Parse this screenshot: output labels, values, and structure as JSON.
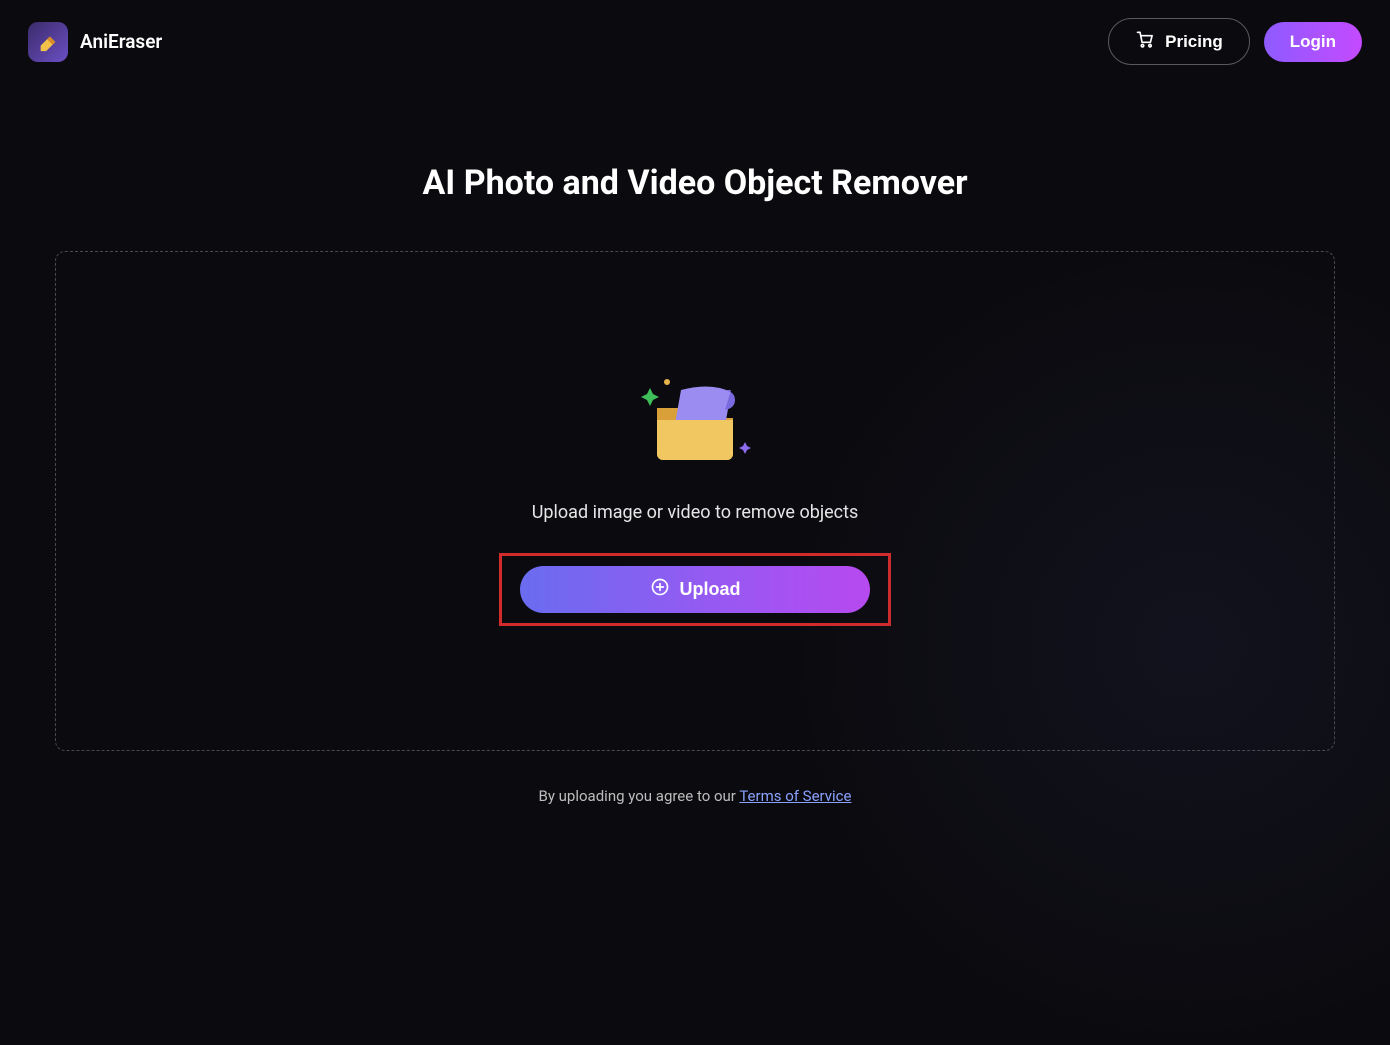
{
  "header": {
    "brand_name": "AniEraser",
    "pricing_label": "Pricing",
    "login_label": "Login"
  },
  "main": {
    "title": "AI Photo and Video Object Remover",
    "drop_caption": "Upload image or video to remove objects",
    "upload_label": "Upload"
  },
  "footer": {
    "agree_prefix": "By uploading you agree to our ",
    "tos_label": "Terms of Service"
  }
}
